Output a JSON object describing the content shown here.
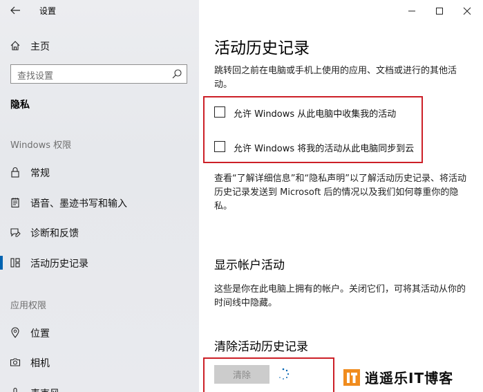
{
  "window": {
    "title": "设置"
  },
  "sidebar": {
    "home_label": "主页",
    "search_placeholder": "查找设置",
    "section_title": "隐私",
    "group_windows": "Windows 权限",
    "windows_items": [
      {
        "label": "常规",
        "icon": "lock-icon"
      },
      {
        "label": "语音、墨迹书写和输入",
        "icon": "notepad-icon"
      },
      {
        "label": "诊断和反馈",
        "icon": "feedback-icon"
      },
      {
        "label": "活动历史记录",
        "icon": "timeline-icon",
        "selected": true
      }
    ],
    "group_apps": "应用权限",
    "app_items": [
      {
        "label": "位置",
        "icon": "location-icon"
      },
      {
        "label": "相机",
        "icon": "camera-icon"
      },
      {
        "label": "麦克风",
        "icon": "microphone-icon"
      }
    ]
  },
  "main": {
    "title": "活动历史记录",
    "intro": "跳转回之前在电脑或手机上使用的应用、文档或进行的其他活动。",
    "checkboxes": [
      {
        "label": "允许 Windows 从此电脑中收集我的活动",
        "checked": false
      },
      {
        "label": "允许 Windows 将我的活动从此电脑同步到云",
        "checked": false
      }
    ],
    "privacy_note": "查看“了解详细信息”和“隐私声明”以了解活动历史记录、将活动历史记录发送到 Microsoft 后的情况以及我们如何尊重你的隐私。",
    "accounts_title": "显示帐户活动",
    "accounts_desc": "这些是你在此电脑上拥有的帐户。关闭它们，可将其活动从你的时间线中隐藏。",
    "clear_title": "清除活动历史记录",
    "clear_button": "清除"
  },
  "watermark": {
    "text": "逍遥乐IT博客"
  },
  "colors": {
    "accent": "#0063b1",
    "highlight_red": "#cc1f27",
    "watermark_orange": "#f08c1e"
  }
}
